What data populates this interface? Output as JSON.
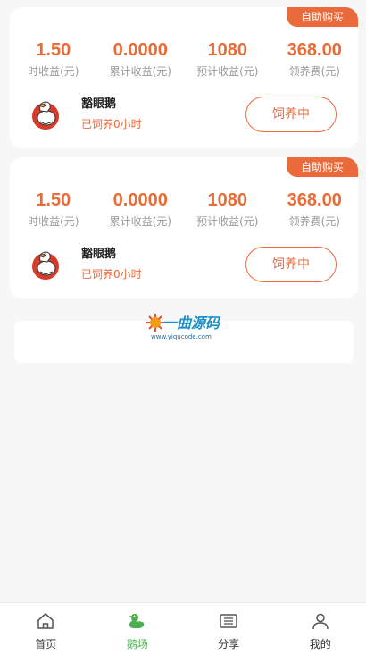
{
  "cards": [
    {
      "badge": "自助购买",
      "stats": [
        {
          "value": "1.50",
          "label": "时收益(元)"
        },
        {
          "value": "0.0000",
          "label": "累计收益(元)"
        },
        {
          "value": "1080",
          "label": "预计收益(元)"
        },
        {
          "value": "368.00",
          "label": "领养费(元)"
        }
      ],
      "goose_name": "豁眼鹅",
      "status": "已饲养0小时",
      "button": "饲养中"
    },
    {
      "badge": "自助购买",
      "stats": [
        {
          "value": "1.50",
          "label": "时收益(元)"
        },
        {
          "value": "0.0000",
          "label": "累计收益(元)"
        },
        {
          "value": "1080",
          "label": "预计收益(元)"
        },
        {
          "value": "368.00",
          "label": "领养费(元)"
        }
      ],
      "goose_name": "豁眼鹅",
      "status": "已饲养0小时",
      "button": "饲养中"
    }
  ],
  "watermark": {
    "name": "一曲源码",
    "url": "www.yiqucode.com"
  },
  "tabbar": {
    "active": 1,
    "items": [
      {
        "label": "首页",
        "icon": "home-icon"
      },
      {
        "label": "鹅场",
        "icon": "goose-icon"
      },
      {
        "label": "分享",
        "icon": "share-icon"
      },
      {
        "label": "我的",
        "icon": "user-icon"
      }
    ]
  },
  "colors": {
    "accent": "#ea6a3b",
    "active_tab": "#4caf50"
  }
}
